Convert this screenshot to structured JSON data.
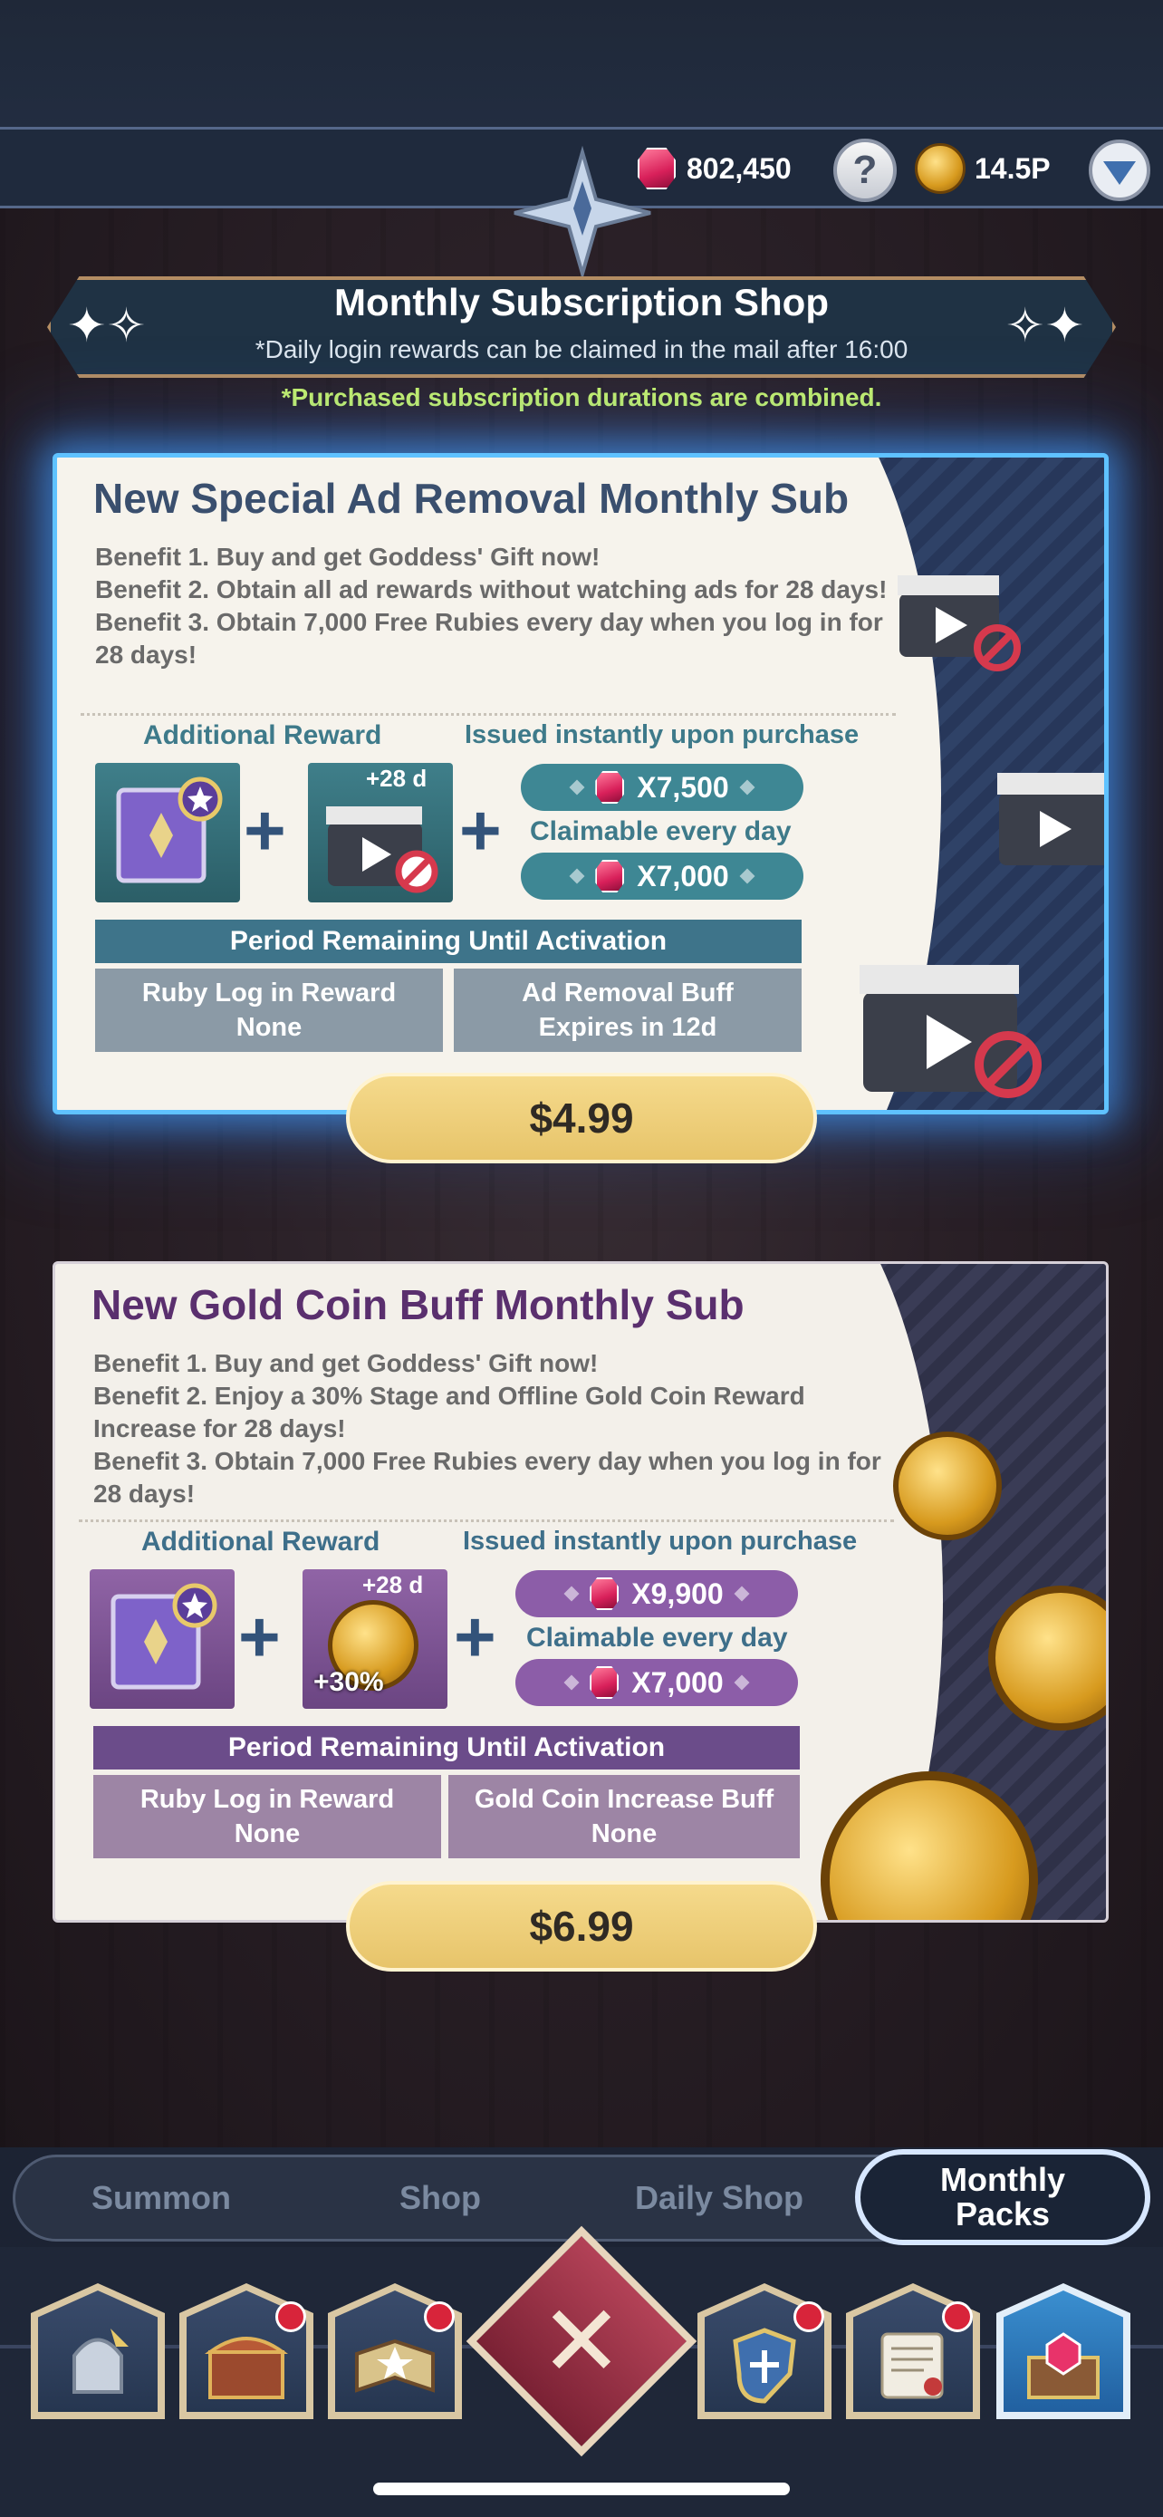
{
  "header": {
    "ruby_amount": "802,450",
    "help_label": "?",
    "gold_amount": "14.5P"
  },
  "banner": {
    "title": "Monthly Subscription Shop",
    "subtitle": "*Daily login rewards can be claimed in the mail after 16:00",
    "note": "*Purchased subscription durations are combined."
  },
  "cards": [
    {
      "title": "New Special Ad Removal Monthly Sub",
      "benefits": [
        "Benefit 1. Buy and get Goddess' Gift now!",
        "Benefit 2. Obtain all ad rewards without watching ads for 28 days!",
        "Benefit 3. Obtain 7,000 Free Rubies every day when you log in for 28 days!"
      ],
      "additional_reward_label": "Additional Reward",
      "issued_label": "Issued instantly upon purchase",
      "item_badge": "+28 d",
      "instant_amount": "X7,500",
      "daily_label": "Claimable every day",
      "daily_amount": "X7,000",
      "period_label": "Period Remaining Until Activation",
      "cell1_title": "Ruby Log in Reward",
      "cell1_value": "None",
      "cell2_title": "Ad Removal Buff",
      "cell2_value": "Expires in 12d",
      "price": "$4.99"
    },
    {
      "title": "New Gold Coin Buff Monthly Sub",
      "benefits": [
        "Benefit 1. Buy and get Goddess' Gift now!",
        "Benefit 2. Enjoy a 30% Stage and Offline Gold Coin Reward Increase for 28 days!",
        "Benefit 3. Obtain 7,000 Free Rubies every day when you log in for 28 days!"
      ],
      "additional_reward_label": "Additional Reward",
      "issued_label": "Issued instantly upon purchase",
      "item_badge": "+28 d",
      "item_bonus": "+30%",
      "instant_amount": "X9,900",
      "daily_label": "Claimable every day",
      "daily_amount": "X7,000",
      "period_label": "Period Remaining Until Activation",
      "cell1_title": "Ruby Log in Reward",
      "cell1_value": "None",
      "cell2_title": "Gold Coin Increase Buff",
      "cell2_value": "None",
      "price": "$6.99"
    }
  ],
  "tabs": [
    "Summon",
    "Shop",
    "Daily Shop"
  ],
  "active_tab": [
    "Monthly",
    "Packs"
  ],
  "nav": [
    "hero-helmet-icon",
    "treasure-chest-icon",
    "spellbook-icon",
    "close-icon",
    "shield-crest-icon",
    "scroll-letter-icon",
    "ruby-chest-icon"
  ],
  "colors": {
    "accent_blue": "#5fc2ff",
    "price_gold": "#e7c46a",
    "note_green": "#c9f56a"
  }
}
